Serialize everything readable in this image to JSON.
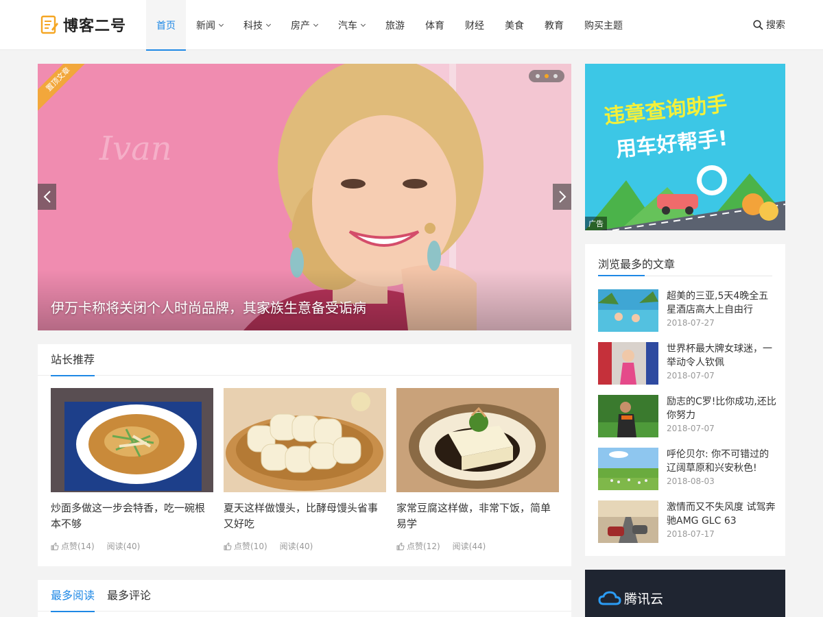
{
  "header": {
    "logo_text": "博客二号",
    "nav": [
      {
        "label": "首页",
        "active": true,
        "dropdown": false
      },
      {
        "label": "新闻",
        "active": false,
        "dropdown": true
      },
      {
        "label": "科技",
        "active": false,
        "dropdown": true
      },
      {
        "label": "房产",
        "active": false,
        "dropdown": true
      },
      {
        "label": "汽车",
        "active": false,
        "dropdown": true
      },
      {
        "label": "旅游",
        "active": false,
        "dropdown": false
      },
      {
        "label": "体育",
        "active": false,
        "dropdown": false
      },
      {
        "label": "财经",
        "active": false,
        "dropdown": false
      },
      {
        "label": "美食",
        "active": false,
        "dropdown": false
      },
      {
        "label": "教育",
        "active": false,
        "dropdown": false
      },
      {
        "label": "购买主题",
        "active": false,
        "dropdown": false
      }
    ],
    "search_label": "搜索"
  },
  "slider": {
    "badge": "置顶文章",
    "title": "伊万卡称将关闭个人时尚品牌，其家族生意备受诟病",
    "active_dot": 2,
    "dot_count": 3
  },
  "recommend": {
    "title": "站长推荐",
    "cards": [
      {
        "title": "炒面多做这一步会特香，吃一碗根本不够",
        "likes": "点赞(14)",
        "reads": "阅读(40)"
      },
      {
        "title": "夏天这样做馒头，比酵母馒头省事又好吃",
        "likes": "点赞(10)",
        "reads": "阅读(40)"
      },
      {
        "title": "家常豆腐这样做，非常下饭，简单易学",
        "likes": "点赞(12)",
        "reads": "阅读(44)"
      }
    ]
  },
  "tabs": {
    "tab1": "最多阅读",
    "tab2": "最多评论"
  },
  "ad": {
    "line1": "违章查询助手",
    "line2": "用车好帮手!",
    "label": "广告"
  },
  "popular": {
    "title": "浏览最多的文章",
    "items": [
      {
        "title": "超美的三亚,5天4晚全五星酒店高大上自由行",
        "date": "2018-07-27"
      },
      {
        "title": "世界杯最大牌女球迷，一举动令人钦佩",
        "date": "2018-07-07"
      },
      {
        "title": "励志的C罗!比你成功,还比你努力",
        "date": "2018-07-07"
      },
      {
        "title": "呼伦贝尔: 你不可错过的辽阔草原和兴安秋色!",
        "date": "2018-08-03"
      },
      {
        "title": "激情而又不失风度 试驾奔驰AMG GLC 63",
        "date": "2018-07-17"
      }
    ]
  },
  "cloud": {
    "name": "腾讯云"
  },
  "colors": {
    "accent": "#1e88e5",
    "badge": "#f2a73b",
    "dot_active": "#f5a623"
  }
}
